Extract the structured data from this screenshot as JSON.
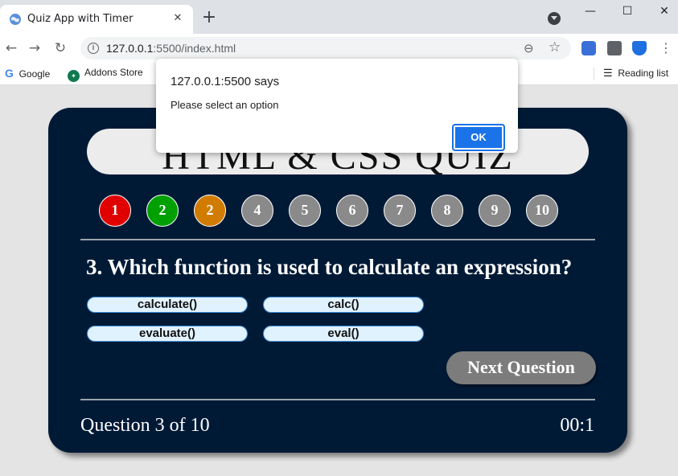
{
  "browser": {
    "tab_title": "Quiz App with Timer",
    "tab_close": "✕",
    "new_tab": "+",
    "url_host": "127.0.0.1",
    "url_path": ":5500/index.html",
    "bookmarks": [
      {
        "label": "Google"
      },
      {
        "label": "Addons Store"
      }
    ],
    "reading_list": "Reading list",
    "window_controls": {
      "minimize": "—",
      "maximize": "☐",
      "close": "✕"
    }
  },
  "quiz": {
    "title": "HTML & CSS QUIZ",
    "progress": [
      {
        "label": "1",
        "state": "wrong"
      },
      {
        "label": "2",
        "state": "right"
      },
      {
        "label": "2",
        "state": "current"
      },
      {
        "label": "4",
        "state": "pending"
      },
      {
        "label": "5",
        "state": "pending"
      },
      {
        "label": "6",
        "state": "pending"
      },
      {
        "label": "7",
        "state": "pending"
      },
      {
        "label": "8",
        "state": "pending"
      },
      {
        "label": "9",
        "state": "pending"
      },
      {
        "label": "10",
        "state": "pending"
      }
    ],
    "question": "3. Which function is used to calculate an expression?",
    "options": [
      "calculate()",
      "calc()",
      "evaluate()",
      "eval()"
    ],
    "next_label": "Next Question",
    "counter": "Question 3 of 10",
    "timer": "00:1"
  },
  "dialog": {
    "title": "127.0.0.1:5500 says",
    "message": "Please select an option",
    "ok_label": "OK"
  },
  "colors": {
    "card_bg": "#001a36",
    "wrong": "#e00000",
    "right": "#00a000",
    "current": "#d17c00",
    "pending": "#8a8a8a",
    "dialog_button": "#1a73e8"
  }
}
